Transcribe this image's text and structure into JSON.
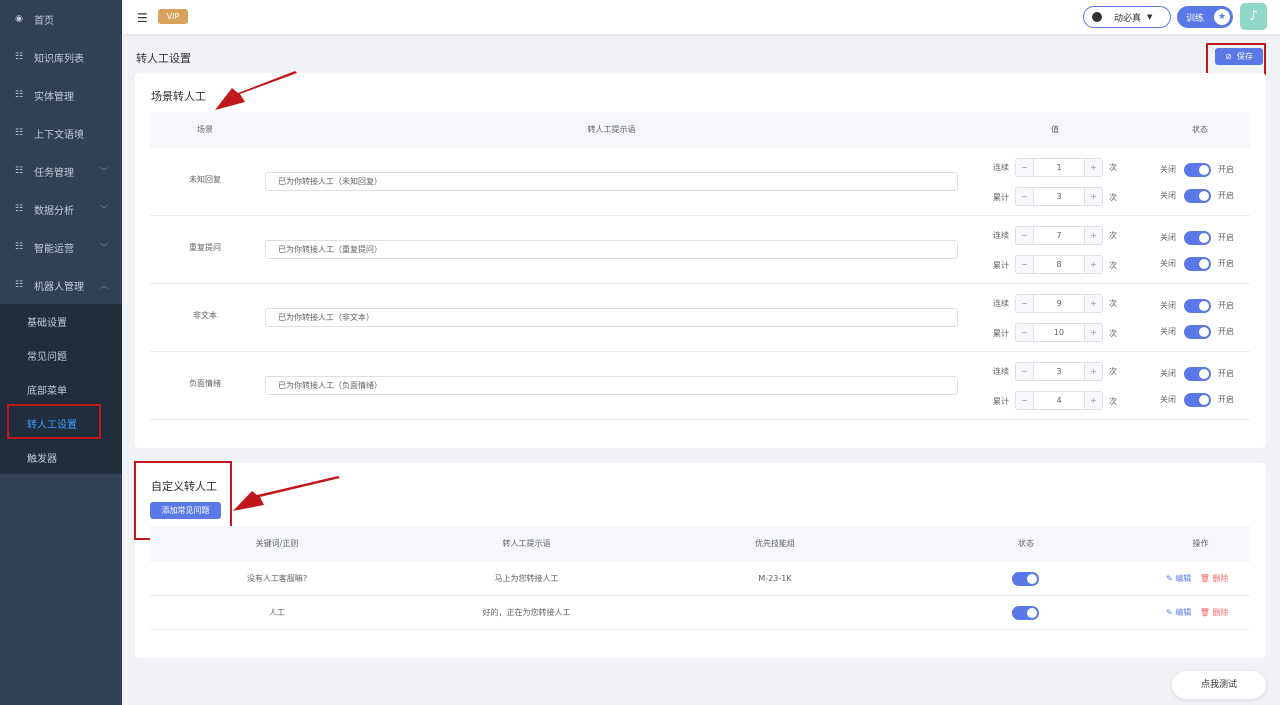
{
  "sidebar": {
    "items": [
      {
        "label": "首页",
        "icon": "dashboard-icon"
      },
      {
        "label": "知识库列表",
        "icon": "list-icon"
      },
      {
        "label": "实体管理",
        "icon": "list-icon"
      },
      {
        "label": "上下文语境",
        "icon": "list-icon"
      },
      {
        "label": "任务管理",
        "icon": "list-icon"
      },
      {
        "label": "数据分析",
        "icon": "list-icon"
      },
      {
        "label": "智能运营",
        "icon": "list-icon"
      },
      {
        "label": "机器人管理",
        "icon": "list-icon"
      }
    ],
    "sub_items": [
      "基础设置",
      "常见问题",
      "底部菜单",
      "转人工设置",
      "触发器"
    ]
  },
  "topbar": {
    "vip": "VIP",
    "user": "动必真",
    "train": "训练"
  },
  "page_title": "转人工设置",
  "save_label": "保存",
  "scene": {
    "title": "场景转人工",
    "headers": {
      "scene": "场景",
      "prompt": "转人工提示语",
      "value": "值",
      "status": "状态"
    },
    "consec_label": "连续",
    "total_label": "累计",
    "unit": "次",
    "off_label": "关闭",
    "on_label": "开启",
    "rows": [
      {
        "name": "未知回复",
        "prompt": "已为你转接人工（未知回复）",
        "consec": "1",
        "total": "3"
      },
      {
        "name": "重复提问",
        "prompt": "已为你转接人工（重复提问）",
        "consec": "7",
        "total": "8"
      },
      {
        "name": "非文本",
        "prompt": "已为你转接人工（非文本）",
        "consec": "9",
        "total": "10"
      },
      {
        "name": "负面情绪",
        "prompt": "已为你转接人工（负面情绪）",
        "consec": "3",
        "total": "4"
      }
    ]
  },
  "custom": {
    "title": "自定义转人工",
    "add_label": "添加常见问题",
    "headers": {
      "keyword": "关键词/正则",
      "prompt": "转人工提示语",
      "group": "优先技能组",
      "status": "状态",
      "ops": "操作"
    },
    "edit_label": "编辑",
    "delete_label": "删除",
    "rows": [
      {
        "keyword": "没有人工客服嘛?",
        "prompt": "马上为您转接人工",
        "group": "M-23-1K"
      },
      {
        "keyword": "人工",
        "prompt": "好的，正在为您转接人工",
        "group": ""
      }
    ]
  },
  "test_label": "点我测试",
  "colors": {
    "primary": "#5a79e8",
    "sidebar": "#304156",
    "annotation": "#c0191d"
  }
}
